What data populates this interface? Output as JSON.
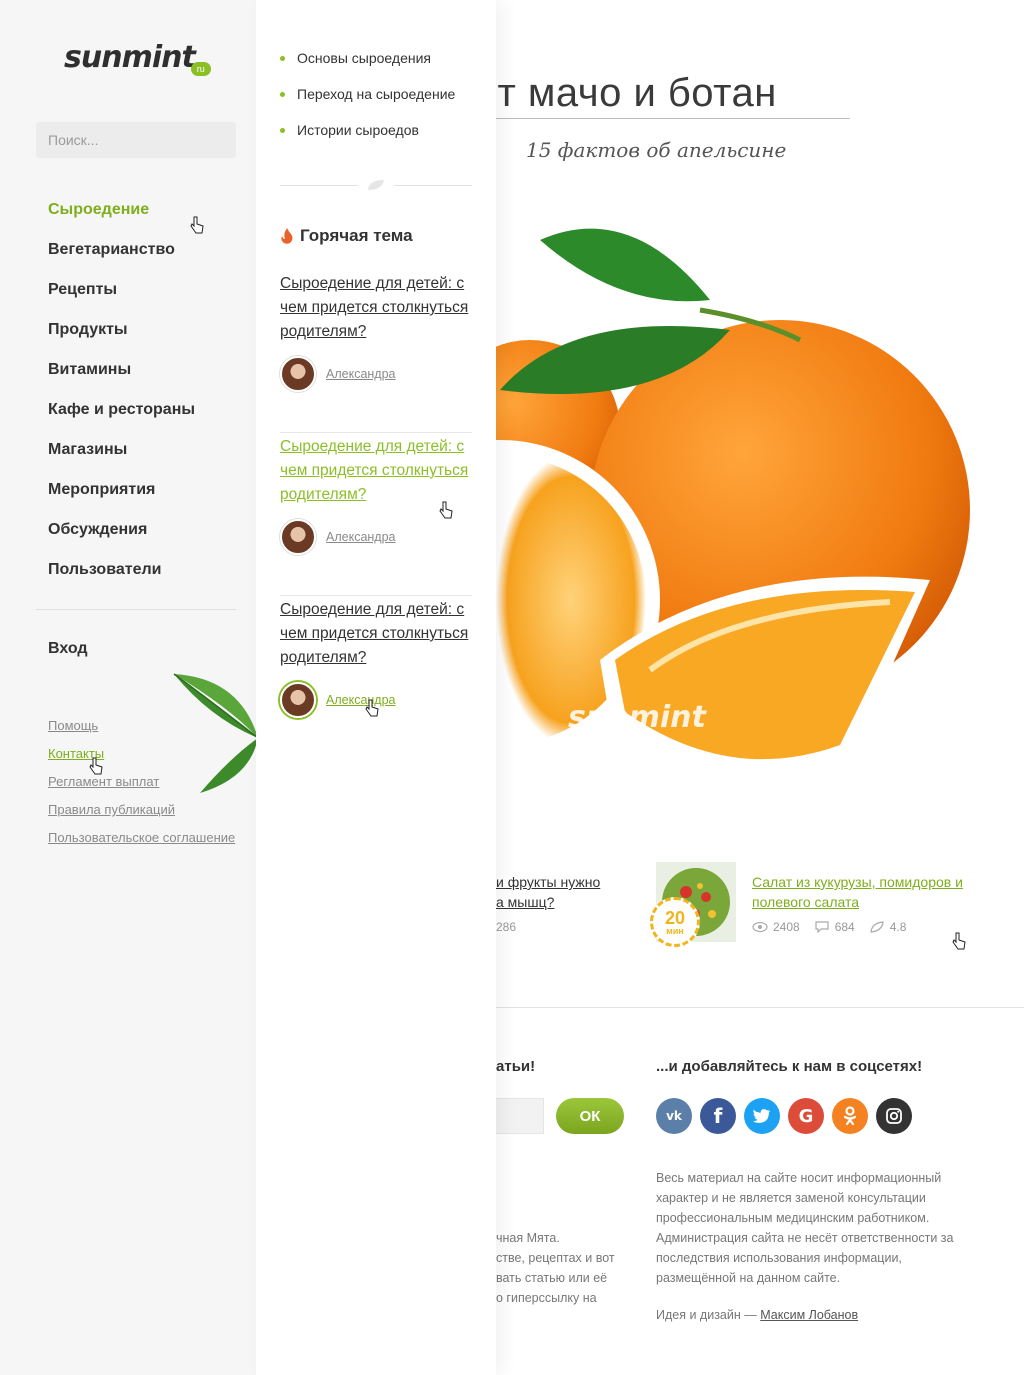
{
  "logo": {
    "text": "sunmint",
    "badge": "ru"
  },
  "search": {
    "placeholder": "Поиск..."
  },
  "nav": {
    "items": [
      {
        "label": "Сыроедение",
        "active": true
      },
      {
        "label": "Вегетарианство"
      },
      {
        "label": "Рецепты"
      },
      {
        "label": "Продукты"
      },
      {
        "label": "Витамины"
      },
      {
        "label": "Кафе и рестораны"
      },
      {
        "label": "Магазины"
      },
      {
        "label": "Мероприятия"
      },
      {
        "label": "Обсуждения"
      },
      {
        "label": "Пользователи"
      }
    ],
    "login": "Вход"
  },
  "footer_links": [
    "Помощь",
    "Контакты",
    "Регламент выплат",
    "Правила публикаций",
    "Пользовательское соглашение"
  ],
  "submenu": {
    "items": [
      "Основы сыроедения",
      "Переход на сыроедение",
      "Истории сыроедов"
    ],
    "hot_title": "Горячая тема",
    "hot_items": [
      {
        "title": "Сыроедение для детей: с чем придется столкнуться родителям?",
        "author": "Александра"
      },
      {
        "title": "Сыроедение для детей: с чем придется столкнуться родителям?",
        "author": "Александра"
      },
      {
        "title": "Сыроедение для детей: с чем придется столкнуться родителям?",
        "author": "Александра"
      }
    ]
  },
  "hero": {
    "title": "обят мачо и ботан",
    "subtitle": "15 фактов об апельсине",
    "watermark": "sunmint"
  },
  "cards": {
    "left": {
      "title_line1": "и фрукты нужно",
      "title_line2": "а мышц?",
      "stat": "286"
    },
    "right": {
      "title": "Салат из кукурузы, помидоров и полевого салата",
      "time_value": "20",
      "time_unit": "мин",
      "views": "2408",
      "comments": "684",
      "rating": "4.8"
    }
  },
  "footer": {
    "subscribe_fragment": "атьи!",
    "ok": "ОК",
    "social_title": "...и добавляйтесь к нам в соцсетях!",
    "social": [
      {
        "name": "vk",
        "label": "vk",
        "color": "#5b7fa8"
      },
      {
        "name": "facebook",
        "label": "f",
        "color": "#3b5998"
      },
      {
        "name": "twitter",
        "label": "t",
        "color": "#1da1f2"
      },
      {
        "name": "google",
        "label": "G",
        "color": "#dd4b39"
      },
      {
        "name": "odnoklassniki",
        "label": "ok",
        "color": "#f58220"
      },
      {
        "name": "instagram",
        "label": "◎",
        "color": "#333333"
      }
    ],
    "disclaimer": "Весь материал на сайте носит информационный характер и не является заменой консультации профессиональным медицинским работником. Администрация сайта не несёт ответственности за последствия использования информации, размещённой на данном сайте.",
    "credit_prefix": "Идея и дизайн — ",
    "credit_name": "Максим Лобанов",
    "fragment_lines": [
      "чная Мята.",
      "стве, рецептах и вот",
      "вать статью или её",
      "о гиперссылку на"
    ]
  }
}
